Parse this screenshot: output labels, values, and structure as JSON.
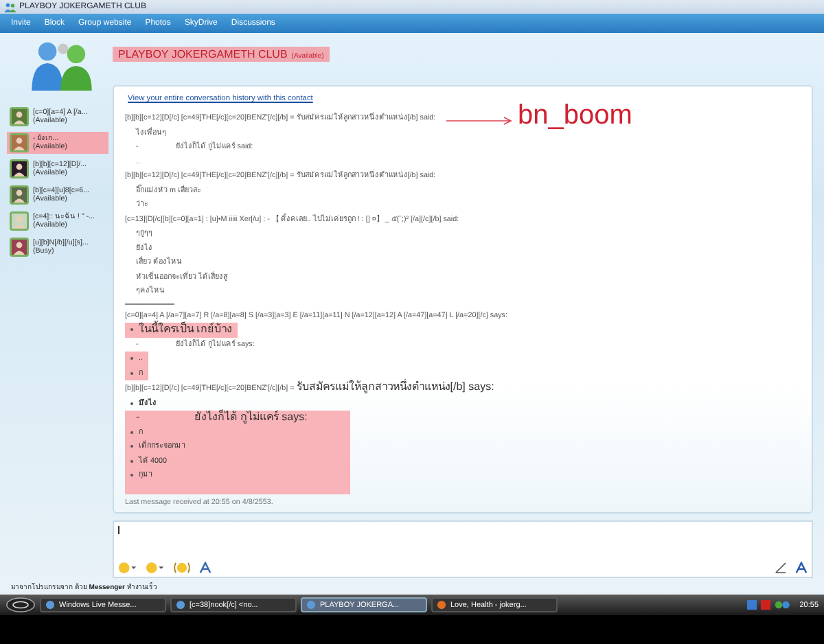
{
  "window": {
    "title": "PLAYBOY  JOKERGAMETH  CLUB"
  },
  "menu": [
    "Invite",
    "Block",
    "Group website",
    "Photos",
    "SkyDrive",
    "Discussions"
  ],
  "header": {
    "name": "PLAYBOY  JOKERGAMETH  CLUB",
    "status": "(Available)"
  },
  "contacts": [
    {
      "name": "[c=0][a=4]  A  [/a...",
      "status": "(Available)",
      "selected": false
    },
    {
      "name": "-              ยังเก...",
      "status": "(Available)",
      "selected": true
    },
    {
      "name": "[b][b][c=12][D]/...",
      "status": "(Available)",
      "selected": false
    },
    {
      "name": "[b][c=4][u]8[c=6...",
      "status": "(Available)",
      "selected": false
    },
    {
      "name": "[c=4]:: นะฉัน ! \" -...",
      "status": "(Available)",
      "selected": false
    },
    {
      "name": "[u][b]N[/b][/u][s]...",
      "status": "(Busy)",
      "selected": false
    }
  ],
  "history_link": "View your entire conversation history with this contact",
  "annotation": "bn_boom",
  "messages": [
    {
      "kind": "sender",
      "text": "[b][b][c=12][D[/c] [c=49]THE[/c][c=20]BENZ'[/c][/b] = รับสมัครแม่ให้ลูกสาวหนึ่งตำแหน่ง[/b] said:"
    },
    {
      "kind": "line",
      "text": "ไงเพื่อนๆ"
    },
    {
      "kind": "line",
      "text": "-                  ยังไงก็ได้ กูไม่แคร์ said:"
    },
    {
      "kind": "line",
      "text": ".."
    },
    {
      "kind": "sender",
      "text": "[b][b][c=12][D[/c] [c=49]THE[/c][c=20]BENZ'[/c][/b] = รับสมัครแม่ให้ลูกสาวหนึ่งตำแหน่ง[/b] said:"
    },
    {
      "kind": "line",
      "text": "อี๊กแม่งหัว m เสี่ยวสะ"
    },
    {
      "kind": "line",
      "text": "ว่าะ"
    },
    {
      "kind": "sender",
      "text": "[c=13][D[/c][b][c=0][a=1] : [u]•M iiiii Xer[/u] : - 【 ดิ้งคเลย.. ไปไม่เค่ยรถูก !  : [] ¤】 _ ๕(¨;)² [/a][/c][/b] said:"
    },
    {
      "kind": "line",
      "text": "ๆกูๆๆ"
    },
    {
      "kind": "line",
      "text": "ยังไง"
    },
    {
      "kind": "line",
      "text": "เสี่ยว ต้องไหน"
    },
    {
      "kind": "line",
      "text": "หัวเซ็นออกจะเที่ยว ได้เสี่ยงสู"
    },
    {
      "kind": "line",
      "text": "ๆคงไหน"
    },
    {
      "kind": "divider"
    },
    {
      "kind": "sender",
      "text": "[c=0][a=4]  A  [/a=7][a=7]  R  [/a=8][a=8]  S  [/a=3][a=3]  E  [/a=11][a=11]  N  [/a=12][a=12]  A  [/a=47][a=47]  L  [/a=20][/c] says:"
    },
    {
      "kind": "group",
      "highlight": true,
      "large": true,
      "lines": [
        "ในนี้ใครเป็น เกย์บ้าง"
      ]
    },
    {
      "kind": "line",
      "text": "-                  ยังไงก็ได้ กูไม่แคร์ says:"
    },
    {
      "kind": "group",
      "highlight": true,
      "large": false,
      "lines": [
        "..",
        "ก"
      ]
    },
    {
      "kind": "sender",
      "text": "[b][b][c=12][D[/c] [c=49]THE[/c][c=20]BENZ'[/c][/b] = ",
      "big": "รับสมัครแม่ให้ลูกสาวหนึ่งตำแหน่ง[/b] says:"
    },
    {
      "kind": "group",
      "highlight": false,
      "large": false,
      "bold": true,
      "lines": [
        "มึงไง"
      ]
    },
    {
      "kind": "group",
      "highlight": true,
      "large": false,
      "title": "-                  ยังไงก็ได้ กูไม่แคร์ says:",
      "lines": [
        "ก",
        "เด็กกระจอกมา",
        "ได้ 4000",
        "กุมา"
      ]
    }
  ],
  "last_message": "Last message received at 20:55 on 4/8/2553.",
  "status_line": "มาจากโปรแกรมจาก ด้วย **Messenger** ทำงานเร็ว",
  "taskbar": [
    {
      "label": "Windows Live Messe...",
      "selected": false
    },
    {
      "label": "[c=38]nook[/c] <no...",
      "selected": false
    },
    {
      "label": "PLAYBOY  JOKERGA...",
      "selected": true
    },
    {
      "label": "Love, Health - jokerg...",
      "selected": false
    }
  ],
  "clock": "20:55"
}
